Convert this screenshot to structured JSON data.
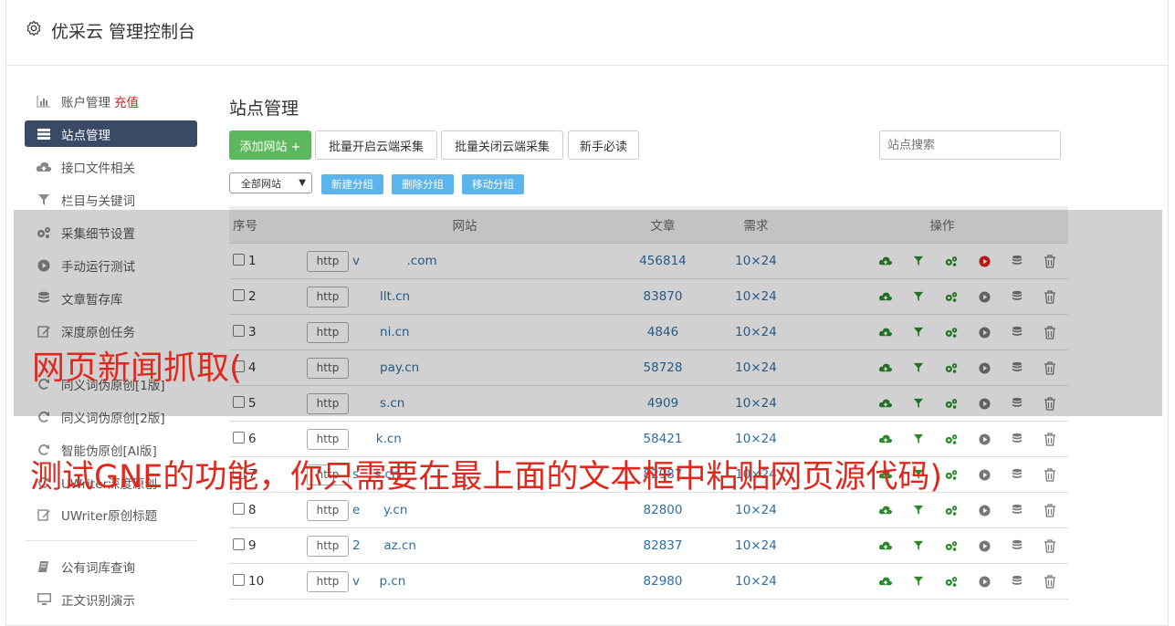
{
  "header": {
    "title": "优采云 管理控制台"
  },
  "sidebar": {
    "items": [
      {
        "label": "账户管理",
        "extra": "充值",
        "icon": "bar-chart-icon"
      },
      {
        "label": "站点管理",
        "icon": "server-list-icon"
      },
      {
        "label": "接口文件相关",
        "icon": "cloud-upload-icon"
      },
      {
        "label": "栏目与关键词",
        "icon": "filter-icon"
      },
      {
        "label": "采集细节设置",
        "icon": "cogs-icon"
      },
      {
        "label": "手动运行测试",
        "icon": "play-circle-icon"
      },
      {
        "label": "文章暂存库",
        "icon": "database-icon"
      },
      {
        "label": "深度原创任务",
        "icon": "edit-icon"
      },
      {
        "label": "同义词伪原创[1版]",
        "icon": "refresh-icon"
      },
      {
        "label": "同义词伪原创[2版]",
        "icon": "refresh-icon"
      },
      {
        "label": "智能伪原创[AI版]",
        "icon": "refresh-icon"
      },
      {
        "label": "UWriter深度原创",
        "icon": "refresh-icon"
      },
      {
        "label": "UWriter原创标题",
        "icon": "edit-icon"
      },
      {
        "label": "公有词库查询",
        "icon": "book-icon"
      },
      {
        "label": "正文识别演示",
        "icon": "monitor-icon"
      }
    ]
  },
  "main": {
    "title": "站点管理",
    "toolbar": {
      "add_site": "添加网站 +",
      "batch_open": "批量开启云端采集",
      "batch_close": "批量关闭云端采集",
      "guide": "新手必读"
    },
    "search": {
      "placeholder": "站点搜索"
    },
    "group_select": "全部网站",
    "group_buttons": {
      "new": "新建分组",
      "delete": "删除分组",
      "move": "移动分组"
    },
    "table": {
      "headers": {
        "no": "序号",
        "site": "网站",
        "articles": "文章",
        "demand": "需求",
        "ops": "操作"
      },
      "rows": [
        {
          "no": "1",
          "proto": "http",
          "site": "v            .com",
          "articles": "456814",
          "demand": "10×24"
        },
        {
          "no": "2",
          "proto": "http",
          "site": "       llt.cn",
          "articles": "83870",
          "demand": "10×24"
        },
        {
          "no": "3",
          "proto": "http",
          "site": "       ni.cn",
          "articles": "4846",
          "demand": "10×24"
        },
        {
          "no": "4",
          "proto": "http",
          "site": "       pay.cn",
          "articles": "58728",
          "demand": "10×24"
        },
        {
          "no": "5",
          "proto": "http",
          "site": "       s.cn",
          "articles": "4909",
          "demand": "10×24"
        },
        {
          "no": "6",
          "proto": "http",
          "site": "      k.cn",
          "articles": "58421",
          "demand": "10×24"
        },
        {
          "no": "7",
          "proto": "http",
          "site": "s    s.cn",
          "articles": "82987",
          "demand": "10×24"
        },
        {
          "no": "8",
          "proto": "http",
          "site": "e      y.cn",
          "articles": "82800",
          "demand": "10×24"
        },
        {
          "no": "9",
          "proto": "http",
          "site": "2      az.cn",
          "articles": "82837",
          "demand": "10×24"
        },
        {
          "no": "10",
          "proto": "http",
          "site": "v     p.cn",
          "articles": "82980",
          "demand": "10×24"
        }
      ]
    }
  },
  "watermark": {
    "line1": "网页新闻抓取(",
    "line2": "测试GNE的功能，你只需要在最上面的文本框中粘贴网页源代码)"
  },
  "colors": {
    "accent_green": "#5cb85c",
    "sidebar_active": "#3a4a66",
    "link_blue": "#2e6da4",
    "small_btn_blue": "#5bb4ec",
    "watermark_red": "#e0281d"
  }
}
